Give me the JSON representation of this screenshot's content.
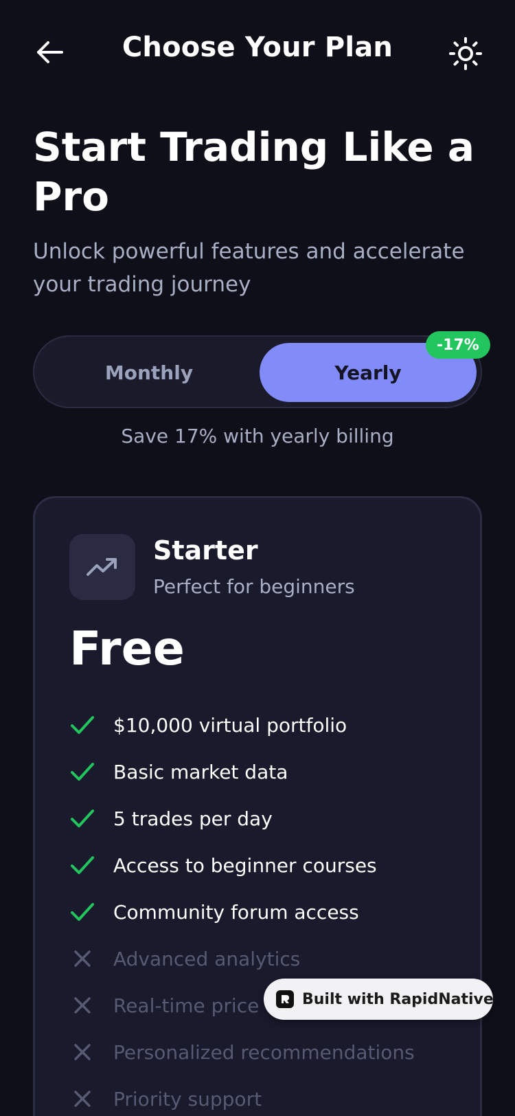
{
  "header": {
    "title": "Choose Your Plan",
    "back_icon": "arrow-left-icon",
    "theme_icon": "sun-icon"
  },
  "hero": {
    "title": "Start Trading Like a Pro",
    "subtitle": "Unlock powerful features and accelerate your trading journey"
  },
  "billing": {
    "monthly_label": "Monthly",
    "yearly_label": "Yearly",
    "selected": "Yearly",
    "discount_badge": "-17%",
    "save_note": "Save 17% with yearly billing"
  },
  "plan": {
    "icon": "trending-up-icon",
    "name": "Starter",
    "tagline": "Perfect for beginners",
    "price": "Free",
    "features": [
      {
        "text": "$10,000 virtual portfolio",
        "included": true
      },
      {
        "text": "Basic market data",
        "included": true
      },
      {
        "text": "5 trades per day",
        "included": true
      },
      {
        "text": "Access to beginner courses",
        "included": true
      },
      {
        "text": "Community forum access",
        "included": true
      },
      {
        "text": "Advanced analytics",
        "included": false
      },
      {
        "text": "Real-time price a",
        "included": false
      },
      {
        "text": "Personalized recommendations",
        "included": false
      },
      {
        "text": "Priority support",
        "included": false
      }
    ]
  },
  "badge": {
    "text": "Built with RapidNative"
  },
  "colors": {
    "background": "#0f0f1a",
    "accent": "#818cf8",
    "success": "#22c55e",
    "card": "#191a2c"
  }
}
